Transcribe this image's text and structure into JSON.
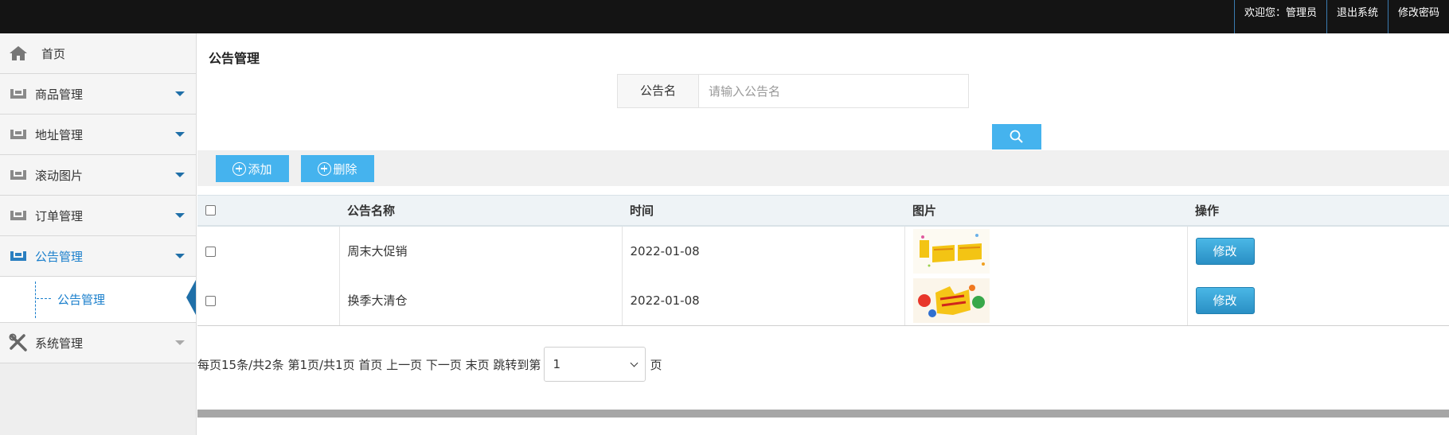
{
  "topbar": {
    "welcome": "欢迎您：管理员",
    "logout": "退出系统",
    "change_password": "修改密码"
  },
  "sidebar": {
    "home": "首页",
    "items": [
      {
        "label": "商品管理",
        "icon": "ribbon-icon"
      },
      {
        "label": "地址管理",
        "icon": "ribbon-icon"
      },
      {
        "label": "滚动图片",
        "icon": "ribbon-icon"
      },
      {
        "label": "订单管理",
        "icon": "ribbon-icon"
      },
      {
        "label": "公告管理",
        "icon": "ribbon-icon",
        "active": true
      },
      {
        "label": "系统管理",
        "icon": "tools-icon"
      }
    ],
    "sub_item": "公告管理"
  },
  "main": {
    "title": "公告管理",
    "search": {
      "label": "公告名",
      "placeholder": "请输入公告名",
      "value": ""
    },
    "toolbar": {
      "add": "添加",
      "delete": "删除"
    },
    "table": {
      "headers": [
        "公告名称",
        "时间",
        "图片",
        "操作"
      ],
      "rows": [
        {
          "name": "周末大促销",
          "time": "2022-01-08",
          "image": "weekend-sale-image",
          "action": "修改"
        },
        {
          "name": "换季大清仓",
          "time": "2022-01-08",
          "image": "season-clearance-image",
          "action": "修改"
        }
      ]
    },
    "pager": {
      "info": "每页15条/共2条 第1页/共1页 首页 上一页 下一页 末页 跳转到第",
      "page_value": "1",
      "suffix": "页"
    }
  },
  "colors": {
    "accent": "#45b3ee",
    "topbar": "#141414",
    "active": "#1a7fcc"
  }
}
